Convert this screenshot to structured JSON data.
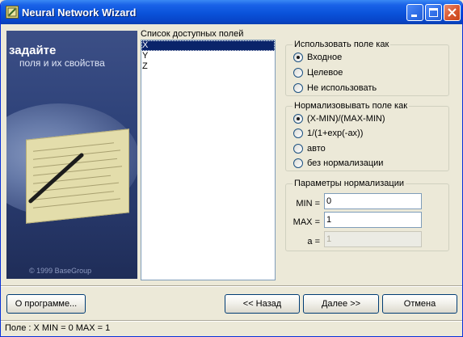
{
  "window": {
    "title": "Neural Network Wizard",
    "title_bar_color": "#0a52da"
  },
  "illustration": {
    "title": "задайте",
    "subtitle": "поля и их свойства",
    "copyright": "© 1999 BaseGroup"
  },
  "fields": {
    "label": "Список доступных полей",
    "items": [
      "X",
      "Y",
      "Z"
    ],
    "selected": "X"
  },
  "usage": {
    "label": "Использовать поле как",
    "options": [
      {
        "label": "Входное",
        "checked": true
      },
      {
        "label": "Целевое",
        "checked": false
      },
      {
        "label": "Не использовать",
        "checked": false
      }
    ]
  },
  "normalize": {
    "label": "Нормализовывать поле как",
    "options": [
      {
        "label": "(X-MIN)/(MAX-MIN)",
        "checked": true
      },
      {
        "label": "1/(1+exp(-ax))",
        "checked": false
      },
      {
        "label": "авто",
        "checked": false
      },
      {
        "label": "без нормализации",
        "checked": false
      }
    ]
  },
  "params": {
    "label": "Параметры нормализации",
    "min_label": "MIN =",
    "min_value": "0",
    "max_label": "MAX =",
    "max_value": "1",
    "a_label": "a =",
    "a_value": "1"
  },
  "buttons": {
    "about": "О программе...",
    "back": "<< Назад",
    "next": "Далее >>",
    "cancel": "Отмена"
  },
  "status": {
    "text": "Поле : X  MIN = 0 MAX = 1"
  },
  "icons": [
    "app-icon",
    "minimize-icon",
    "maximize-icon",
    "close-icon"
  ]
}
